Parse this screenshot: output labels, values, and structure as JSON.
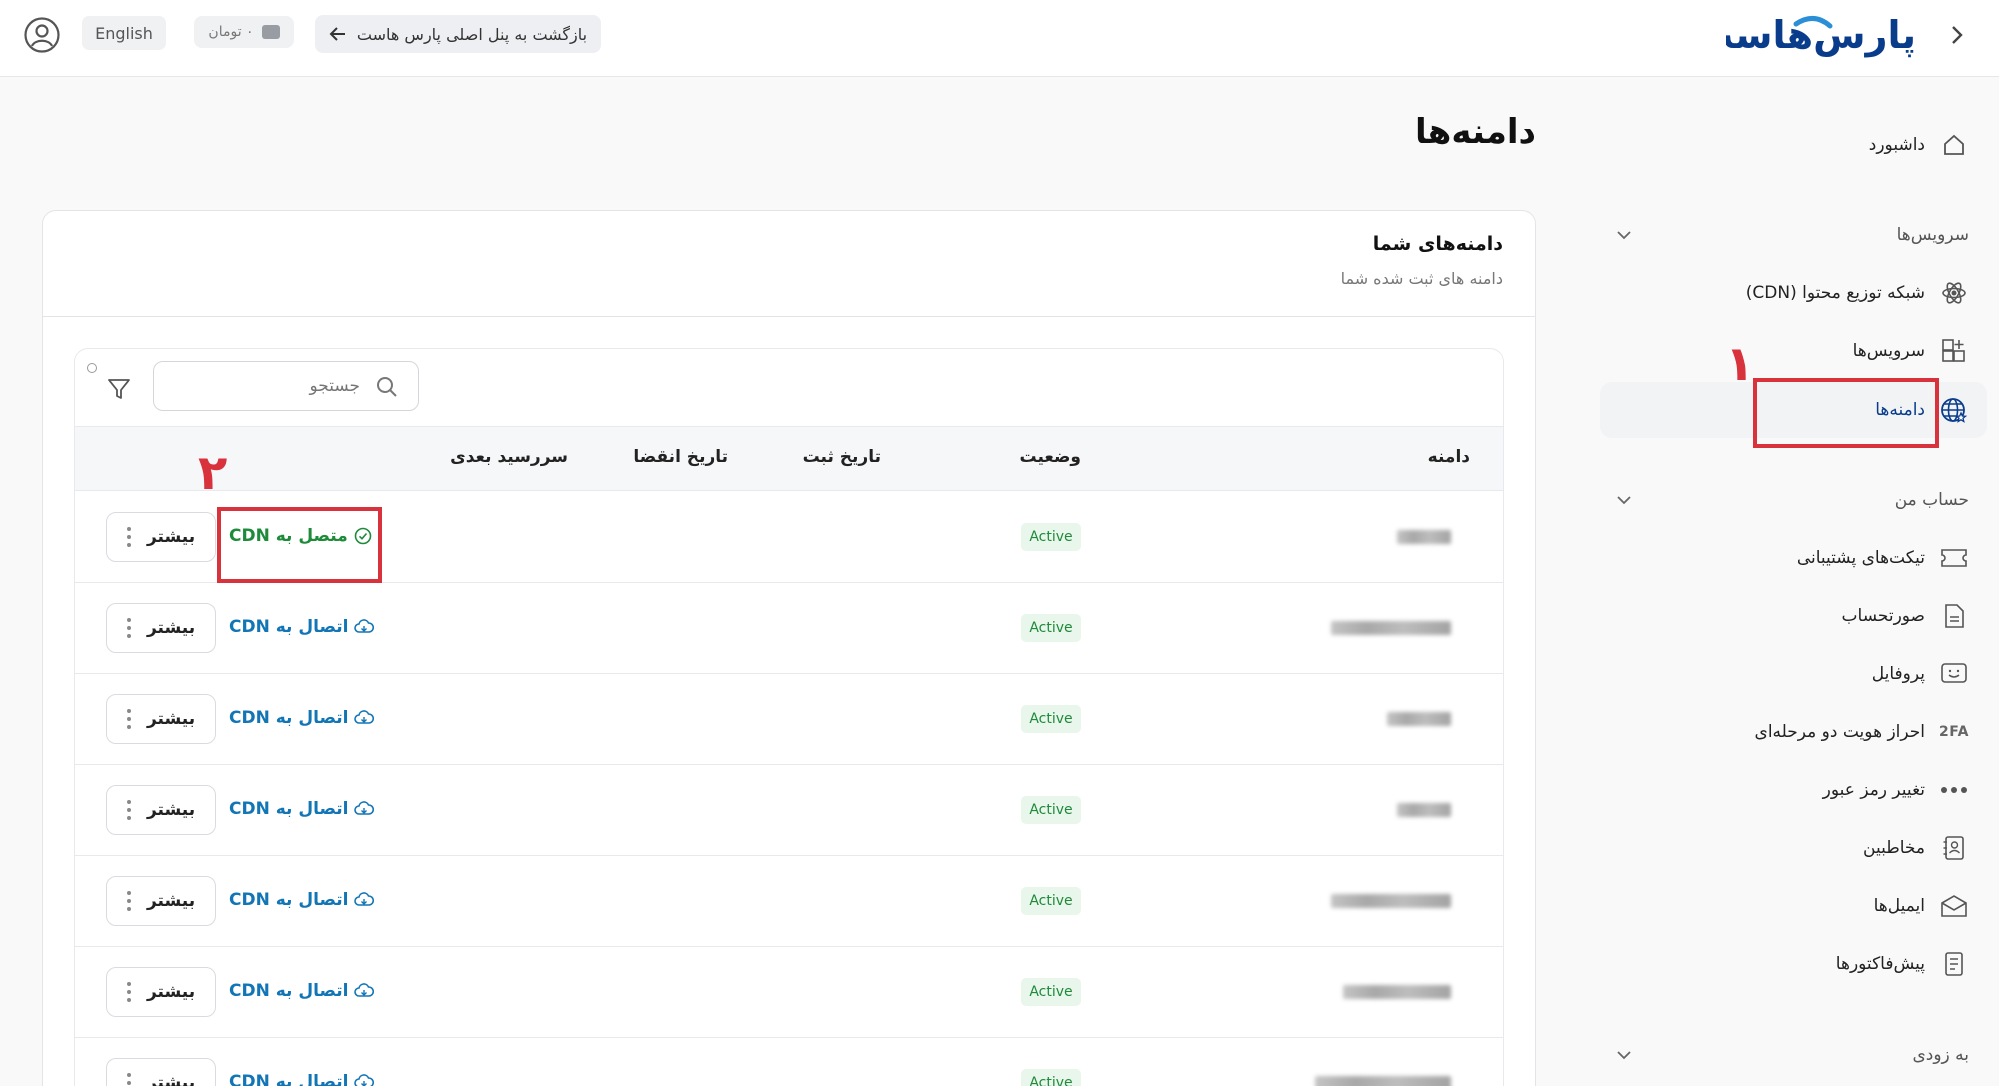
{
  "header": {
    "language_label": "English",
    "wallet_text": "۰ تومان",
    "back_label": "بازگشت به پنل اصلی پارس هاست",
    "logo_text": "پارس‌هاست"
  },
  "sidebar": {
    "dashboard": "داشبورد",
    "services_section": "سرویس‌ها",
    "items_services": [
      {
        "label": "شبکه توزیع محتوا (CDN)",
        "icon": "atom-icon"
      },
      {
        "label": "سرویس‌ها",
        "icon": "grid-plus-icon"
      },
      {
        "label": "دامنه‌ها",
        "icon": "globe-icon"
      }
    ],
    "account_section": "حساب من",
    "items_account": [
      {
        "label": "تیکت‌های پشتیبانی",
        "icon": "ticket-icon"
      },
      {
        "label": "صورتحساب",
        "icon": "document-icon"
      },
      {
        "label": "پروفایل",
        "icon": "smile-card-icon"
      },
      {
        "label": "احراز هویت دو مرحله‌ای",
        "icon": "twofa-icon"
      },
      {
        "label": "تغییر رمز عبور",
        "icon": "password-dots-icon"
      },
      {
        "label": "مخاطبین",
        "icon": "contacts-icon"
      },
      {
        "label": "ایمیل‌ها",
        "icon": "mail-icon"
      },
      {
        "label": "پیش‌فاکتورها",
        "icon": "invoice-icon"
      }
    ],
    "soon_section": "به زودی",
    "twofa_text": "2FA"
  },
  "annotations": {
    "one": "۱",
    "two": "۲"
  },
  "main": {
    "page_title": "دامنه‌ها",
    "card_title": "دامنه‌های شما",
    "card_subtitle": "دامنه های ثبت شده شما",
    "search_placeholder": "جستجو",
    "columns": [
      "دامنه",
      "وضعیت",
      "تاریخ ثبت",
      "تاریخ انقضا",
      "سررسید بعدی"
    ],
    "more_label": "بیشتر",
    "rows": [
      {
        "status": "Active",
        "cdn": "متصل به CDN",
        "connected": true
      },
      {
        "status": "Active",
        "cdn": "اتصال به CDN",
        "connected": false
      },
      {
        "status": "Active",
        "cdn": "اتصال به CDN",
        "connected": false
      },
      {
        "status": "Active",
        "cdn": "اتصال به CDN",
        "connected": false
      },
      {
        "status": "Active",
        "cdn": "اتصال به CDN",
        "connected": false
      },
      {
        "status": "Active",
        "cdn": "اتصال به CDN",
        "connected": false
      },
      {
        "status": "Active",
        "cdn": "اتصال به CDN",
        "connected": false
      }
    ]
  },
  "colors": {
    "accent_blue": "#1275b5",
    "success_green": "#1e8b3b",
    "annotation_red": "#d8323c",
    "logo_blue": "#0a3c8c"
  }
}
